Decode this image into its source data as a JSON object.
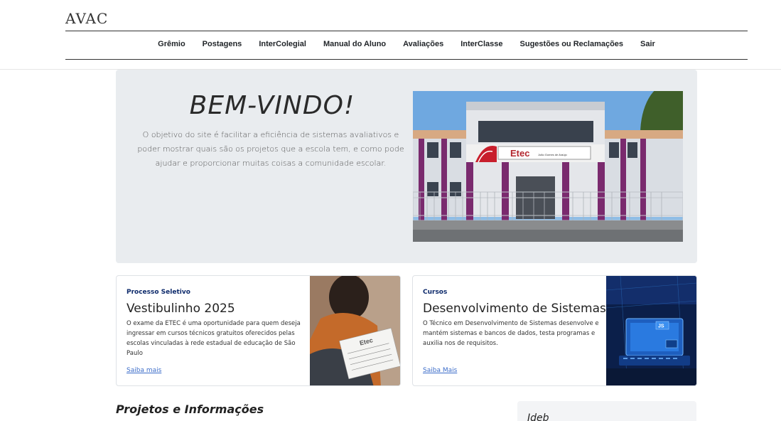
{
  "brand": {
    "logo": "AVAC"
  },
  "nav": {
    "items": [
      {
        "label": "Grêmio"
      },
      {
        "label": "Postagens"
      },
      {
        "label": "InterColegial"
      },
      {
        "label": "Manual do Aluno"
      },
      {
        "label": "Avaliações"
      },
      {
        "label": "InterClasse"
      },
      {
        "label": "Sugestões ou Reclamações"
      },
      {
        "label": "Sair"
      }
    ]
  },
  "hero": {
    "title": "BEM-VINDO!",
    "text": "O objetivo do site é facilitar a eficiência de sistemas avaliativos e poder mostrar quais são os projetos que a escola tem, e como pode ajudar e proporcionar muitas coisas a comunidade escolar.",
    "image": {
      "sign_brand": "Etec",
      "sign_name": "João Gomes de Araújo"
    }
  },
  "cards": [
    {
      "category": "Processo Seletivo",
      "title": "Vestibulinho 2025",
      "description": "O exame da ETEC é uma oportunidade para quem deseja ingressar em cursos técnicos gratuitos oferecidos pelas escolas vinculadas à rede estadual de educação de São Paulo",
      "link": "Saiba mais",
      "paper_text": "Etec"
    },
    {
      "category": "Cursos",
      "title": "Desenvolvimento de Sistemas",
      "description": "O Técnico em Desenvolvimento de Sistemas desenvolve e mantém sistemas e bancos de dados, testa programas e auxilia nos de requisitos.",
      "link": "Saiba Mais",
      "screen_text": "JS"
    }
  ],
  "sections": {
    "projects_title": "Projetos e Informações",
    "ideb_title": "Ideb"
  },
  "colors": {
    "hero_bg": "#e9ecef",
    "link": "#3b6cc9",
    "category": "#0d2a6b"
  }
}
